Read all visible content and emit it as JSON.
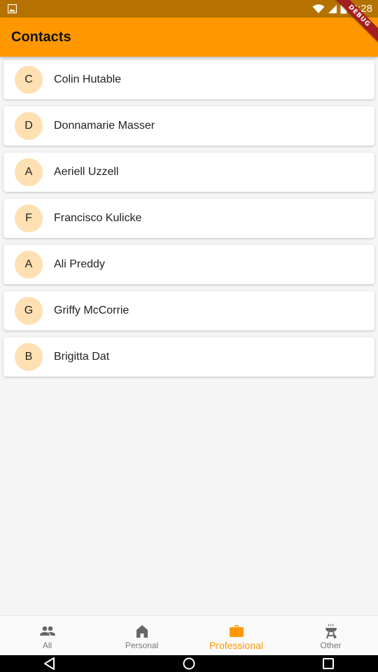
{
  "status_bar": {
    "time": "4:28",
    "icons": [
      "image-icon",
      "wifi-icon",
      "signal-icon",
      "battery-icon"
    ]
  },
  "app_bar": {
    "title": "Contacts",
    "background": "#ff9800"
  },
  "debug_banner": "DEBUG",
  "contacts": [
    {
      "initial": "C",
      "name": "Colin Hutable"
    },
    {
      "initial": "D",
      "name": "Donnamarie Masser"
    },
    {
      "initial": "A",
      "name": "Aeriell Uzzell"
    },
    {
      "initial": "F",
      "name": "Francisco Kulicke"
    },
    {
      "initial": "A",
      "name": "Ali Preddy"
    },
    {
      "initial": "G",
      "name": "Griffy McCorrie"
    },
    {
      "initial": "B",
      "name": "Brigitta Dat"
    }
  ],
  "bottom_nav": {
    "items": [
      {
        "label": "All",
        "icon": "people-icon",
        "active": false
      },
      {
        "label": "Personal",
        "icon": "home-icon",
        "active": false
      },
      {
        "label": "Professional",
        "icon": "briefcase-icon",
        "active": true
      },
      {
        "label": "Other",
        "icon": "grill-icon",
        "active": false
      }
    ],
    "active_color": "#ff9800",
    "inactive_color": "#777777"
  },
  "system_nav": {
    "buttons": [
      "back-icon",
      "home-circle-icon",
      "recents-icon"
    ]
  }
}
